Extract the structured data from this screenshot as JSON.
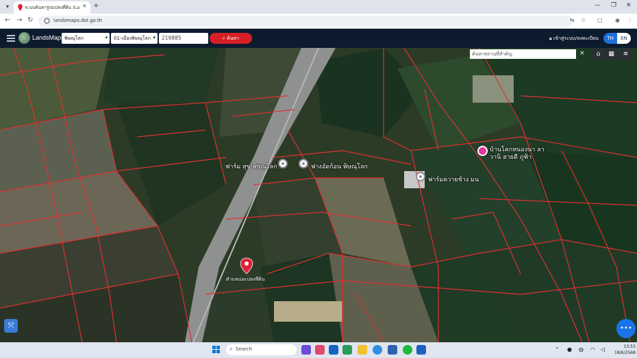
{
  "browser": {
    "tab_title": "ระบบค้นหารูปแปลงที่ดิน (LandsMaps)",
    "tab_close": "×",
    "new_tab": "+",
    "url": "landsmaps.dol.go.th",
    "window_controls": [
      "—",
      "❐",
      "✕"
    ]
  },
  "app": {
    "brand": "LandsMaps",
    "province": "พิษณุโลก",
    "district": "01-เมืองพิษณุโลก",
    "parcel_no": "219885",
    "search_label": "ค้นหา",
    "login_label": "เข้าสู่ระบบ/ลงทะเบียน",
    "lang_th": "TH",
    "lang_en": "EN"
  },
  "map": {
    "search_placeholder": "ค้นหาสถานที่สำคัญ",
    "clear": "×",
    "pois": [
      {
        "label": "ฟาร์ม สุข พิษณุโลก"
      },
      {
        "label": "ฟางอัดก้อน พิษณุโลก"
      },
      {
        "label": "ฟาร์มควายช้าง มน"
      },
      {
        "label": "บ้านโคกหนองนา ลา วานิ ฮายดี ภูฟ้า"
      }
    ],
    "marker_label": "ตำแหน่งแปลงที่ดิน",
    "colors": {
      "parcel_line": "#e03030",
      "marker": "#e0213a",
      "poi_pink": "#e0399a"
    }
  },
  "taskbar": {
    "search_label": "Search",
    "time": "13:53",
    "date": "18/6/2568"
  }
}
